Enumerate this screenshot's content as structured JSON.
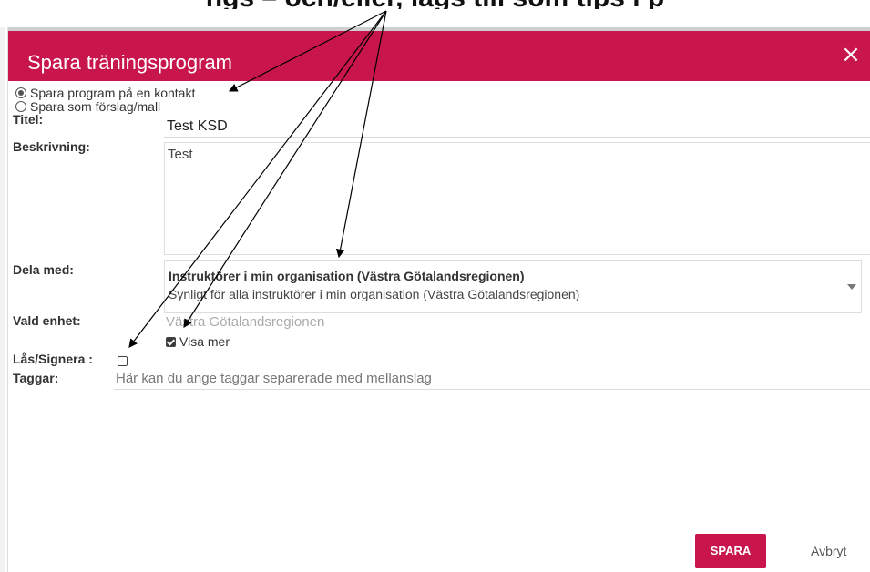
{
  "top_caption": "ngs – och/eller, lägs till som tips i p",
  "dialog": {
    "title": "Spara träningsprogram",
    "close_icon": "close-icon",
    "accent_color": "#c8154b"
  },
  "save_options": {
    "on_contact": "Spara program på en kontakt",
    "as_template": "Spara som förslag/mall",
    "selected": "on_contact"
  },
  "form": {
    "title_label": "Titel:",
    "title_value": "Test KSD",
    "description_label": "Beskrivning:",
    "description_value": "Test",
    "share_label": "Dela med:",
    "share_title": "Instruktörer i min organisation (Västra Götalandsregionen)",
    "share_subtitle": "Synligt för alla instruktörer i min organisation (Västra Götalandsregionen)",
    "unit_label": "Vald enhet:",
    "unit_value": "Västra Götalandsregionen",
    "show_more_label": "Visa mer",
    "show_more_checked": true,
    "lock_label": "Lås/Signera :",
    "lock_checked": false,
    "tags_label": "Taggar:",
    "tags_placeholder": "Här kan du ange taggar separerade med mellanslag"
  },
  "actions": {
    "save_label": "SPARA",
    "cancel_label": "Avbryt"
  }
}
